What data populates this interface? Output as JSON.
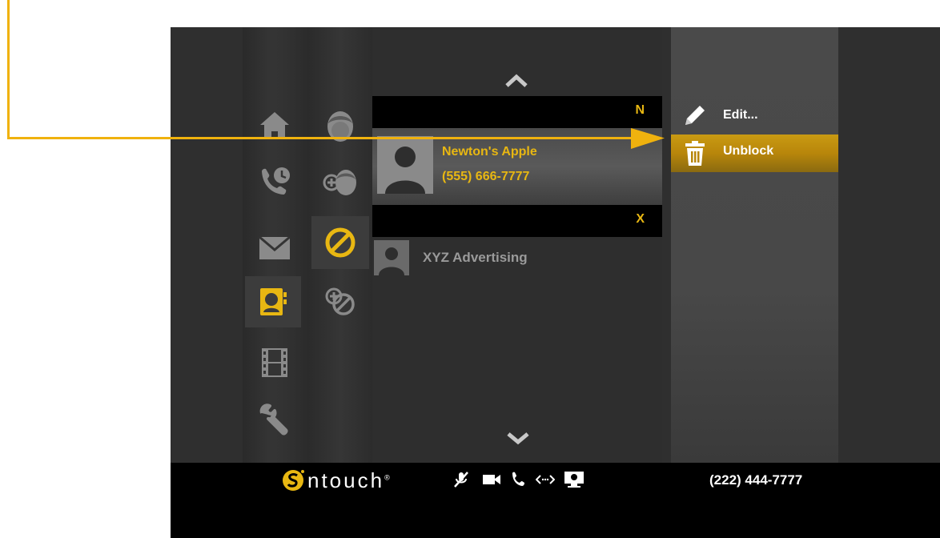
{
  "app": {
    "brand": "ntouch",
    "brand_mark": "®",
    "own_number": "(222) 444-7777"
  },
  "colors": {
    "accent": "#e8b712",
    "highlight": "#b8860b",
    "callout": "#f0b20e"
  },
  "primary_nav": [
    {
      "name": "home",
      "icon": "home-icon",
      "active": false
    },
    {
      "name": "call-history",
      "icon": "phone-clock-icon",
      "active": false
    },
    {
      "name": "messages",
      "icon": "envelope-icon",
      "active": false
    },
    {
      "name": "contacts",
      "icon": "contact-book-icon",
      "active": true
    },
    {
      "name": "videos",
      "icon": "film-icon",
      "active": false
    },
    {
      "name": "settings",
      "icon": "wrench-icon",
      "active": false
    }
  ],
  "secondary_nav": [
    {
      "name": "contacts-list",
      "icon": "person-face-icon",
      "active": false
    },
    {
      "name": "add-contact",
      "icon": "add-person-icon",
      "active": false
    },
    {
      "name": "blocked",
      "icon": "blocked-icon",
      "active": true
    },
    {
      "name": "add-blocked",
      "icon": "add-blocked-icon",
      "active": false
    }
  ],
  "contact_list": {
    "scroll_up": "scroll-up-icon",
    "scroll_down": "scroll-down-icon",
    "sections": [
      {
        "letter": "N",
        "contacts": [
          {
            "name": "Newton's Apple",
            "phone": "(555) 666-7777",
            "selected": true
          }
        ]
      },
      {
        "letter": "X",
        "contacts": [
          {
            "name": "XYZ Advertising",
            "selected": false
          }
        ]
      }
    ]
  },
  "context_menu": {
    "items": [
      {
        "label": "Edit...",
        "icon": "pencil-icon",
        "highlighted": false
      },
      {
        "label": "Unblock",
        "icon": "trash-icon",
        "highlighted": true
      }
    ]
  },
  "status_icons": [
    "mute-mic-icon",
    "video-camera-icon",
    "phone-icon",
    "arrows-icon",
    "monitor-icon"
  ]
}
